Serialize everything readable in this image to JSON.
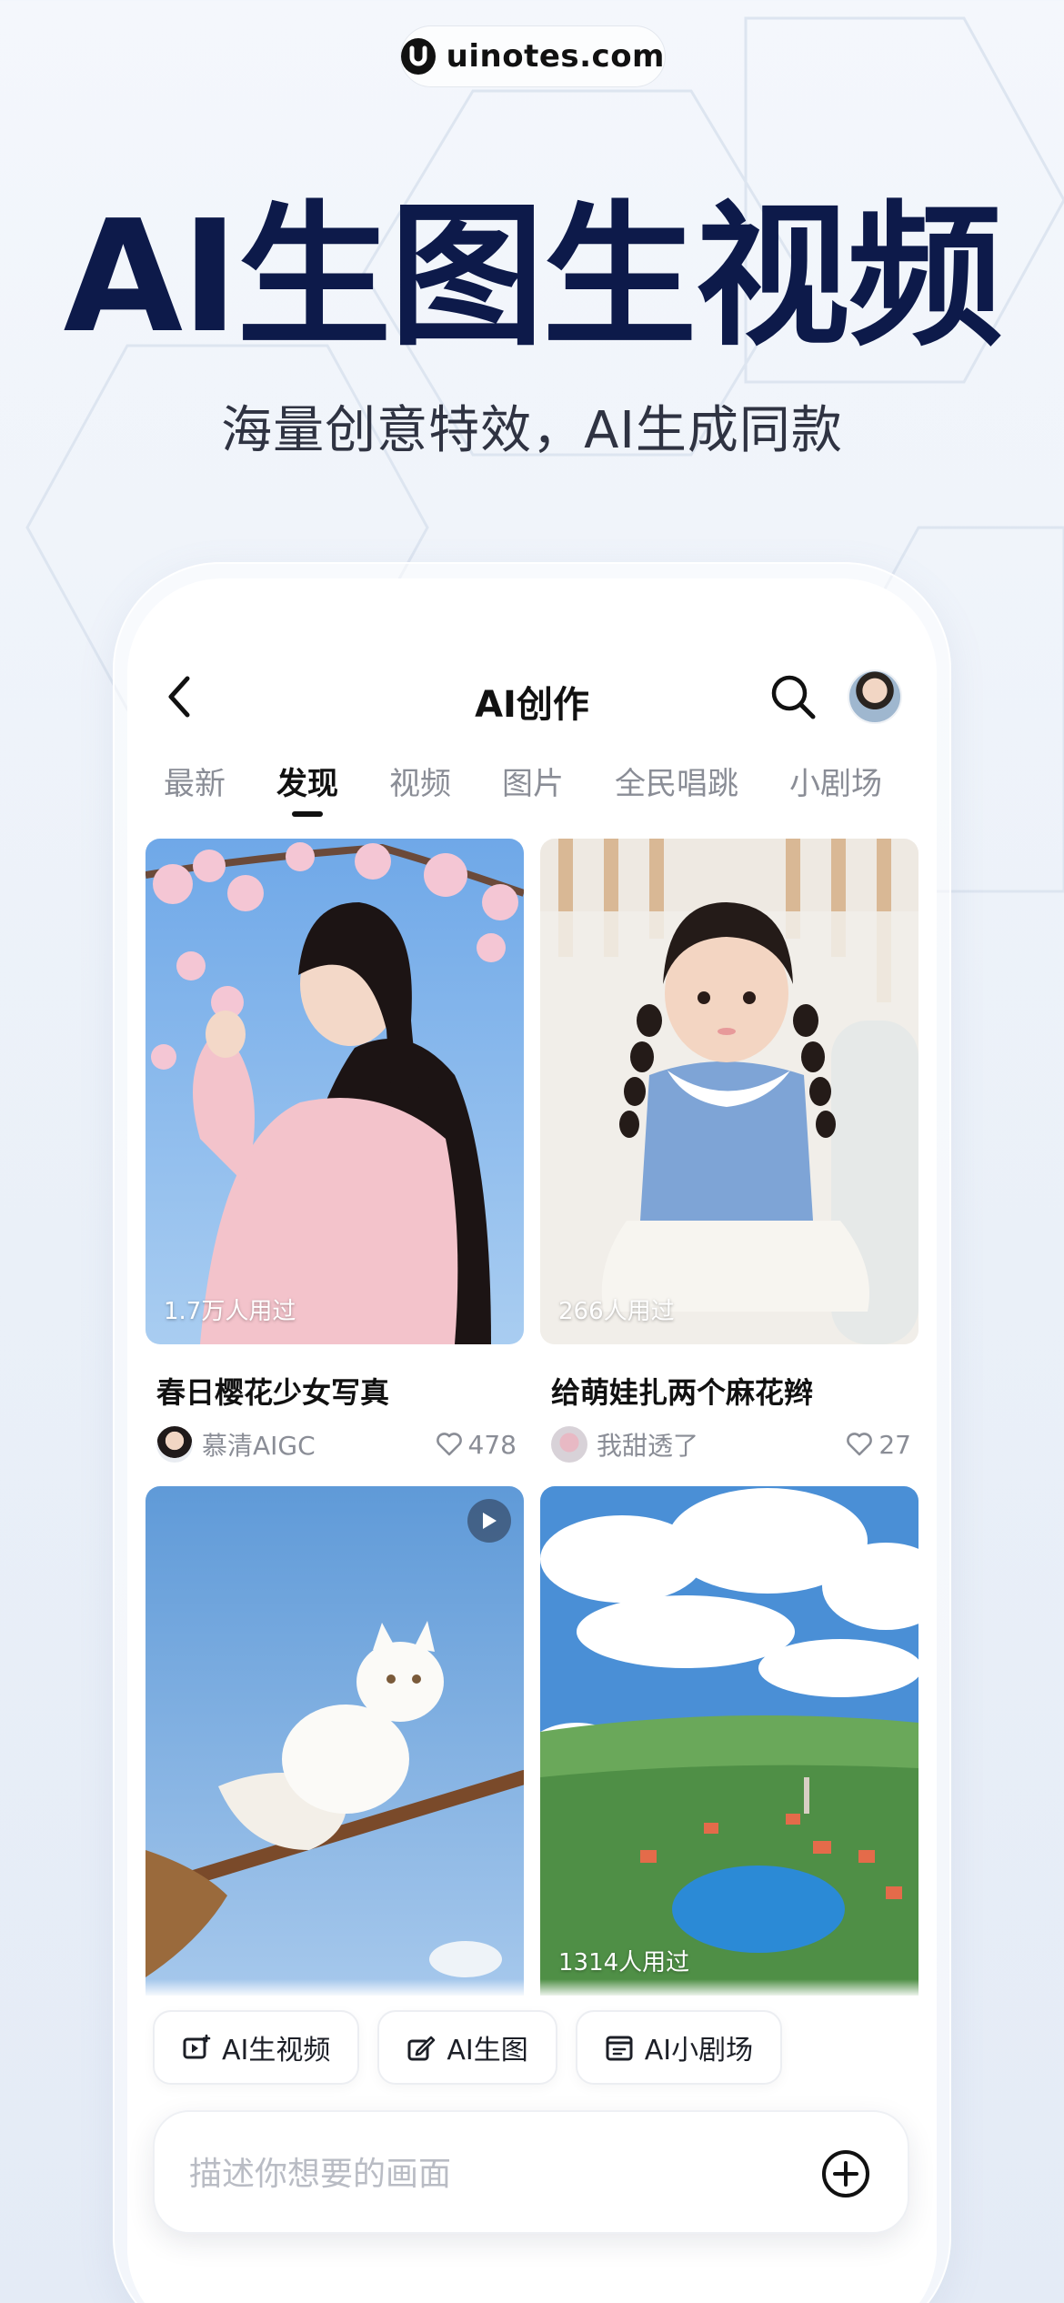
{
  "watermark": {
    "text": "uinotes.com"
  },
  "hero": {
    "title": "AI生图生视频",
    "subtitle": "海量创意特效，AI生成同款"
  },
  "app": {
    "title": "AI创作",
    "tabs": [
      {
        "label": "最新",
        "active": false
      },
      {
        "label": "发现",
        "active": true
      },
      {
        "label": "视频",
        "active": false
      },
      {
        "label": "图片",
        "active": false
      },
      {
        "label": "全民唱跳",
        "active": false
      },
      {
        "label": "小剧场",
        "active": false
      }
    ],
    "cards": [
      {
        "usage": "1.7万人用过",
        "title": "春日樱花少女写真",
        "author": "慕清AIGC",
        "likes": "478",
        "icon": "image-thumbnail"
      },
      {
        "usage": "266人用过",
        "title": "给萌娃扎两个麻花辫",
        "author": "我甜透了",
        "likes": "27",
        "icon": "image-thumbnail"
      },
      {
        "usage": "",
        "title": "",
        "author": "",
        "likes": "",
        "icon": "play-icon"
      },
      {
        "usage": "1314人用过",
        "title": "",
        "author": "",
        "likes": "",
        "icon": "image-thumbnail"
      }
    ],
    "quick_actions": [
      {
        "label": "AI生视频",
        "icon": "video-spark-icon"
      },
      {
        "label": "AI生图",
        "icon": "pen-image-icon"
      },
      {
        "label": "AI小剧场",
        "icon": "theater-icon"
      }
    ],
    "prompt": {
      "placeholder": "描述你想要的画面",
      "value": ""
    },
    "accent": "#0d1a4a"
  }
}
